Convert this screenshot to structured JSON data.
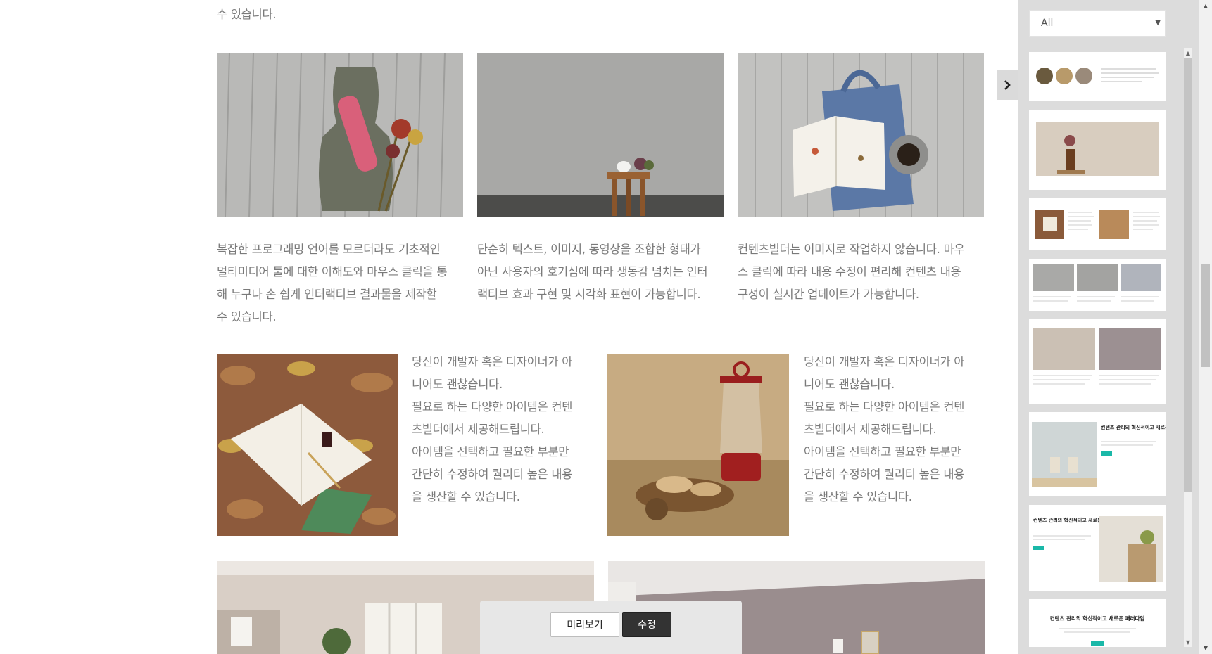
{
  "content": {
    "top_text": "수 있습니다.",
    "columns": [
      {
        "lines": [
          "복잡한 프로그래밍 언어를 모르더라도 기초적인",
          "멀티미디어 툴에 대한 이해도와 마우스 클릭을 통",
          "해 누구나 손 쉽게 인터랙티브 결과물을 제작할",
          "수 있습니다."
        ]
      },
      {
        "lines": [
          "단순히 텍스트, 이미지, 동영상을 조합한 형태가",
          "아닌 사용자의 호기심에 따라 생동감 넘치는 인터",
          "랙티브 효과 구현 및 시각화 표현이 가능합니다."
        ]
      },
      {
        "lines": [
          "컨텐츠빌더는 이미지로 작업하지 않습니다. 마우",
          "스 클릭에 따라 내용 수정이 편리해 컨텐츠 내용",
          "구성이 실시간 업데이트가 가능합니다."
        ]
      }
    ],
    "side_blocks": [
      {
        "lines": [
          "당신이 개발자 혹은 디자이너가 아",
          "니어도 괜찮습니다.",
          "필요로 하는 다양한 아이템은 컨텐",
          "츠빌더에서 제공해드립니다.",
          "아이템을 선택하고 필요한 부분만",
          "간단히 수정하여 퀄리티 높은 내용",
          "을 생산할 수 있습니다."
        ]
      },
      {
        "lines": [
          "당신이 개발자 혹은 디자이너가 아",
          "니어도 괜찮습니다.",
          "필요로 하는 다양한 아이템은 컨텐",
          "츠빌더에서 제공해드립니다.",
          "아이템을 선택하고 필요한 부분만",
          "간단히 수정하여 퀄리티 높은 내용",
          "을 생산할 수 있습니다."
        ]
      }
    ]
  },
  "edit_bar": {
    "preview_label": "미리보기",
    "edit_label": "수정"
  },
  "side_panel": {
    "filter": {
      "selected": "All"
    },
    "thumbnails": {
      "t6_title": "컨텐츠 관리의 혁신적이고 새로운 패러다임",
      "t7_title": "컨텐츠 관리의 혁신적이고 새로운 패러다임",
      "t8_title": "컨텐츠 관리의 혁신적이고 새로운 패러다임"
    }
  },
  "colors": {
    "text": "#7a7a7a",
    "panel_bg": "#dcdcdc",
    "edit_button": "#333333",
    "accent_teal": "#1ab8a8"
  },
  "icons": {
    "panel_toggle": "chevron-right-icon",
    "filter_caret": "caret-down-icon"
  }
}
